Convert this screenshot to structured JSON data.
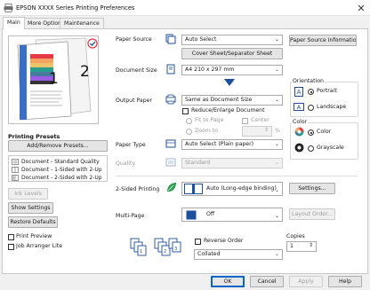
{
  "window": {
    "title": "EPSON XXXX Series Printing Preferences",
    "close_glyph": "✕",
    "app_icon": "printer-icon"
  },
  "tabs": [
    {
      "label": "Main",
      "active": true
    },
    {
      "label": "More Options",
      "active": false
    },
    {
      "label": "Maintenance",
      "active": false
    }
  ],
  "preview": {
    "page_numbers": [
      "1",
      "2"
    ]
  },
  "printing_presets": {
    "heading": "Printing Presets",
    "add_remove_label": "Add/Remove Presets...",
    "items": [
      "Document - Standard Quality",
      "Document - 1-Sided with 2-Up",
      "Document - 2-Sided with 2-Up"
    ]
  },
  "left_buttons": {
    "ink_levels": "Ink Levels",
    "show_settings": "Show Settings",
    "restore_defaults": "Restore Defaults"
  },
  "left_checks": {
    "print_preview": "Print Preview",
    "job_arranger_lite": "Job Arranger Lite"
  },
  "paper_source": {
    "label": "Paper Source",
    "value": "Auto Select",
    "cover_sheet_button": "Cover Sheet/Separator Sheet",
    "info_button": "Paper Source Informatio"
  },
  "document_size": {
    "label": "Document Size",
    "value": "A4 210 x 297 mm"
  },
  "output_paper": {
    "label": "Output Paper",
    "value": "Same as Document Size",
    "reduce_enlarge": "Reduce/Enlarge Document",
    "fit_to_page": "Fit to Page",
    "center": "Center",
    "zoom_to": "Zoom to",
    "zoom_unit": "%"
  },
  "orientation": {
    "heading": "Orientation",
    "portrait": "Portrait",
    "landscape": "Landscape",
    "selected": "Portrait"
  },
  "color": {
    "heading": "Color",
    "color": "Color",
    "grayscale": "Grayscale",
    "selected": "Color"
  },
  "paper_type": {
    "label": "Paper Type",
    "value": "Auto Select (Plain paper)"
  },
  "quality": {
    "label": "Quality",
    "value": "Standard"
  },
  "two_sided": {
    "label": "2-Sided Printing",
    "value": "Auto (Long-edge binding)",
    "settings_button": "Settings..."
  },
  "multi_page": {
    "label": "Multi-Page",
    "value": "Off",
    "layout_order_button": "Layout Order..."
  },
  "order": {
    "reverse_order": "Reverse Order",
    "collate_value": "Collated"
  },
  "copies": {
    "label": "Copies",
    "value": "1"
  },
  "footer": {
    "ok": "OK",
    "cancel": "Cancel",
    "apply": "Apply",
    "help": "Help"
  },
  "colors": {
    "accent_blue": "#1e4f9c",
    "preview_blue": "#3a6fc4",
    "epson_green": "#2e9e4f"
  }
}
